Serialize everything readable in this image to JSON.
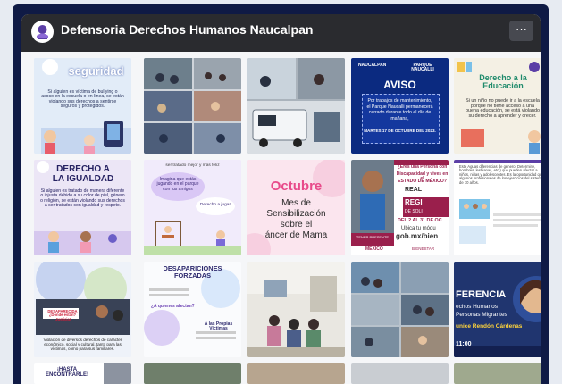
{
  "page": {
    "title": "Defensoria Derechos Humanos Naucalpan",
    "more_label": "···"
  },
  "posts": {
    "p1": {
      "heading": "seguridad",
      "body": "Si alguien es víctima de bullying o acoso en la escuela o en línea, se están violando sus derechos a sentirse seguros y protegidos."
    },
    "p3": {
      "logo": "NAUCALPAN",
      "logo2": "PARQUE NAUCALLI",
      "heading": "AVISO",
      "body": "Por trabajos de mantenimiento, el Parque Naucalli permanecerá cerrado durante todo el día de mañana,",
      "date": "MARTES 17 DE OCTUBRE DEL 2023."
    },
    "p4": {
      "heading": "Derecho a la Educación",
      "body": "Si un niño no puede ir a la escuela porque no tiene acceso a una buena educación, se está violando su derecho a aprender y crecer."
    },
    "p5": {
      "heading": "DERECHO A LA IGUALDAD",
      "body": "Si alguien es tratado de manera diferente o injusta debido a su color de piel, género o religión, se están violando sus derechos a ser tratados con igualdad y respeto."
    },
    "p6": {
      "top": "ser tratado mejor y más feliz",
      "bubble1": "Imagina que estás jugando en el parque con tus amigos",
      "bubble2": "Derecho a jugar"
    },
    "p7": {
      "line1": "Octubre",
      "line2": "Mes de",
      "line3": "Sensibilización",
      "line4": "sobre el",
      "line5": "áncer de Mama"
    },
    "p8": {
      "q1": "¿Eres una Persona con",
      "q2": "Discapacidad y vives en el",
      "q3": "ESTADO DE MÉXICO?",
      "reg1": "REAL",
      "reg2": "REGI",
      "reg3": "DE SOLI",
      "dates": "DEL 2 AL 31 DE OC",
      "ubica": "Ubica tu módu",
      "url": "gob.mx/bien",
      "footer1": "MÉXICO",
      "footer2": "BIENESTAR",
      "tag": "TENER PRESENTE"
    },
    "p9": {
      "lines": "Este Aguas diferencias de género. Determine, hombres, lesbianas, etc.) que pueden afectar a niños, niñas y adolescentes. Es la oportunidad que algunos profesionales de los ejercicios del sistema de 10 años."
    },
    "p10": {
      "body": "Violación de diversos derechos de carácter económico, social y cultural, tanto para las víctimas, como para sus familiares.",
      "sign": "DESAPARECIDA ¿Dónde están? ¡Justicia!"
    },
    "p11": {
      "heading": "DESAPARICIONES FORZADAS",
      "sub": "¿A quienes afectan?",
      "sub2": "A las Propias Víctimas"
    },
    "p14": {
      "line1": "FERENCIA",
      "line2": "echos Humanos",
      "line3": "Personas Migrantes",
      "name": "unice Rendón Cárdenas",
      "time": "11:00"
    },
    "p15": {
      "heading": "¡HASTA ENCONTRARLE!"
    }
  },
  "colors": {
    "frame": "#0f1a45",
    "header": "#2a2b2f",
    "aviso_blue": "#0b2a80",
    "octubre_pink": "#e84a8a"
  }
}
